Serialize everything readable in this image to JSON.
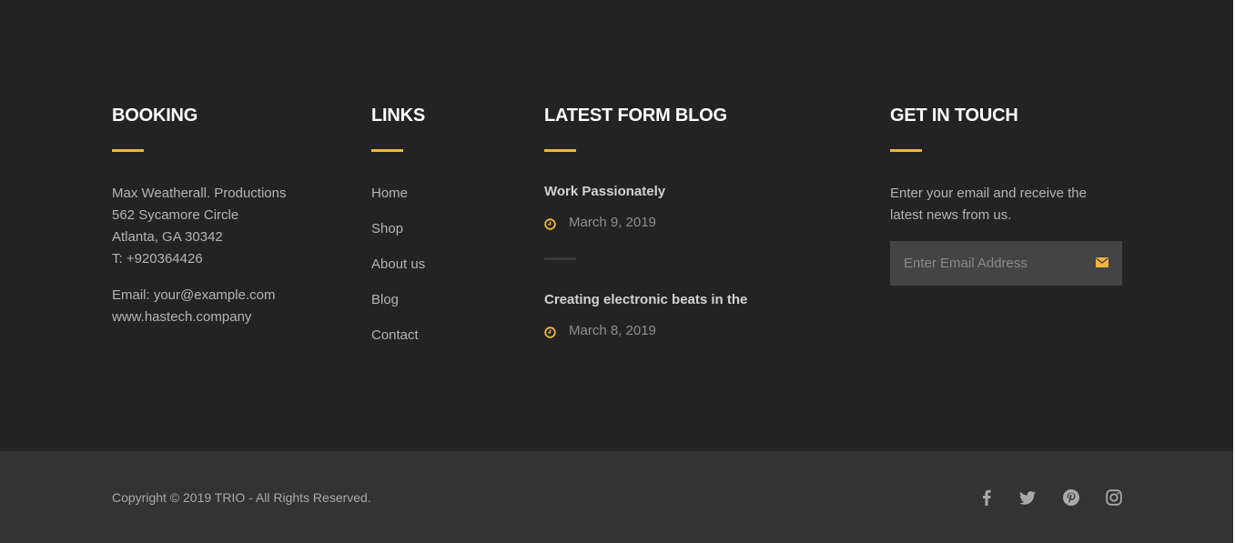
{
  "booking": {
    "title": "BOOKING",
    "lines": [
      "Max Weatherall. Productions",
      "562 Sycamore Circle",
      "Atlanta, GA 30342",
      "T: +920364426"
    ],
    "email": "Email: your@example.com",
    "website": "www.hastech.company"
  },
  "links": {
    "title": "LINKS",
    "items": [
      "Home",
      "Shop",
      "About us",
      "Blog",
      "Contact"
    ]
  },
  "blog": {
    "title": "LATEST FORM BLOG",
    "posts": [
      {
        "title": "Work Passionately",
        "date": "March 9, 2019"
      },
      {
        "title": "Creating electronic beats in the",
        "date": "March 8, 2019"
      }
    ]
  },
  "touch": {
    "title": "GET IN TOUCH",
    "text": "Enter your email and receive the latest news from us.",
    "email_placeholder": "Enter Email Address",
    "submit_icon": "envelope-icon"
  },
  "bottom": {
    "copyright": "Copyright © 2019 TRIO - All Rights Reserved.",
    "social": [
      "facebook-icon",
      "twitter-icon",
      "pinterest-icon",
      "instagram-icon"
    ]
  },
  "colors": {
    "background": "#232323",
    "bottom_bar": "#333333",
    "accent": "#f2b442",
    "heading": "#ffffff",
    "text": "#b4b4b4"
  }
}
